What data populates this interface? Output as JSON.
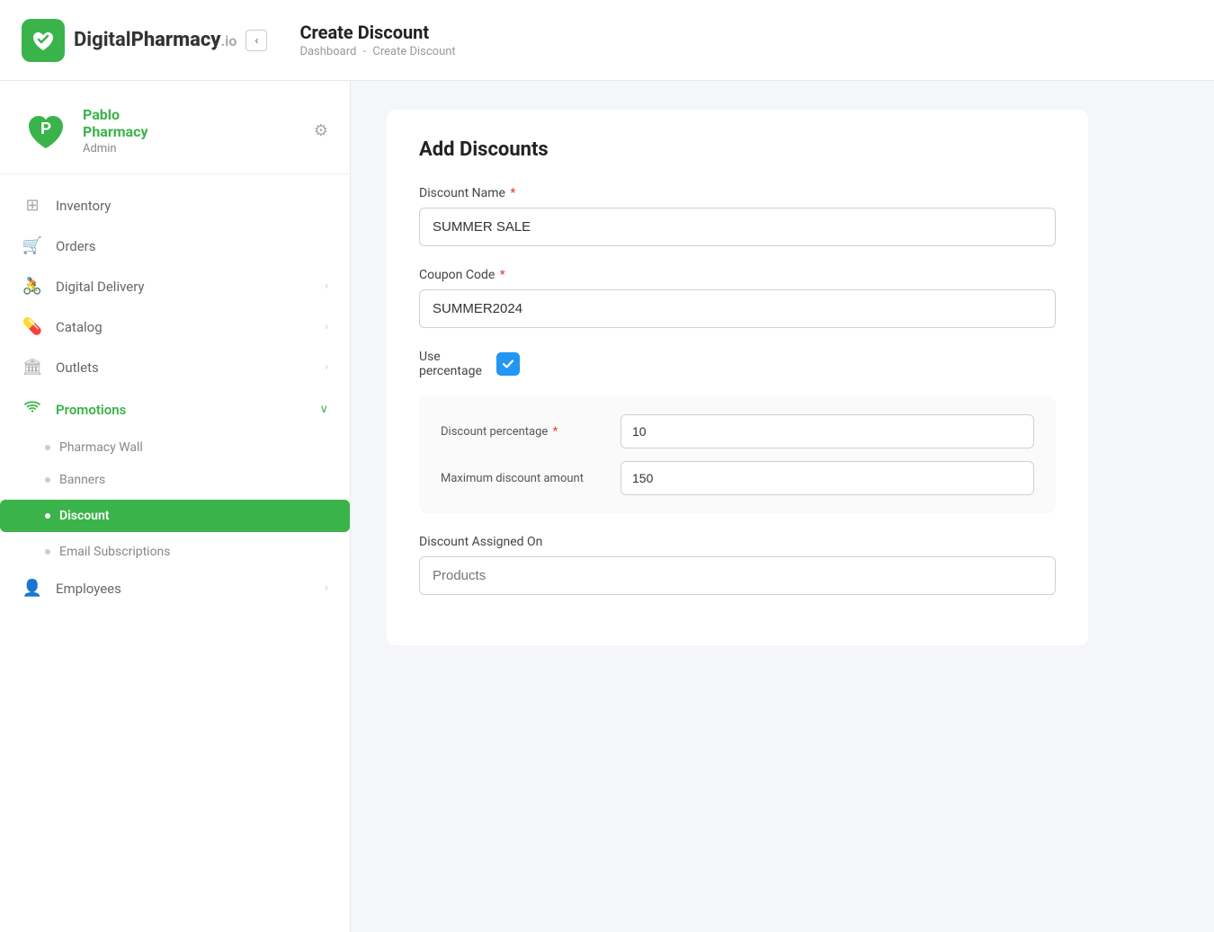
{
  "header": {
    "logo_text_regular": "Digital",
    "logo_text_bold": "Pharmacy",
    "logo_suffix": ".io",
    "page_title": "Create Discount",
    "breadcrumb_home": "Dashboard",
    "breadcrumb_separator": "-",
    "breadcrumb_current": "Create Discount"
  },
  "sidebar": {
    "user": {
      "initial": "P",
      "name_line1": "Pablo",
      "name_line2": "Pharmacy",
      "role": "Admin"
    },
    "nav_items": [
      {
        "id": "inventory",
        "label": "Inventory",
        "icon": "grid"
      },
      {
        "id": "orders",
        "label": "Orders",
        "icon": "cart"
      },
      {
        "id": "digital-delivery",
        "label": "Digital Delivery",
        "icon": "bike",
        "has_chevron": true
      },
      {
        "id": "catalog",
        "label": "Catalog",
        "icon": "pill",
        "has_chevron": true
      },
      {
        "id": "outlets",
        "label": "Outlets",
        "icon": "building",
        "has_chevron": true
      },
      {
        "id": "promotions",
        "label": "Promotions",
        "icon": "wifi",
        "has_chevron": true,
        "active": true
      }
    ],
    "promotions_sub": [
      {
        "id": "pharmacy-wall",
        "label": "Pharmacy Wall"
      },
      {
        "id": "banners",
        "label": "Banners"
      },
      {
        "id": "discount",
        "label": "Discount",
        "active": true
      },
      {
        "id": "email-subscriptions",
        "label": "Email Subscriptions"
      }
    ],
    "nav_items_after": [
      {
        "id": "employees",
        "label": "Employees",
        "icon": "person",
        "has_chevron": true
      }
    ]
  },
  "form": {
    "title": "Add Discounts",
    "discount_name_label": "Discount Name",
    "discount_name_required": true,
    "discount_name_value": "SUMMER SALE",
    "coupon_code_label": "Coupon Code",
    "coupon_code_required": true,
    "coupon_code_value": "SUMMER2024",
    "use_percentage_label": "Use\npercentage",
    "use_percentage_checked": true,
    "discount_percentage_label": "Discount percentage",
    "discount_percentage_required": true,
    "discount_percentage_value": "10",
    "max_discount_label": "Maximum discount amount",
    "max_discount_value": "150",
    "assigned_on_label": "Discount Assigned On",
    "assigned_on_placeholder": "Products"
  },
  "colors": {
    "green": "#3ab44a",
    "blue_checkbox": "#2196f3",
    "active_nav_bg": "#3ab44a"
  }
}
